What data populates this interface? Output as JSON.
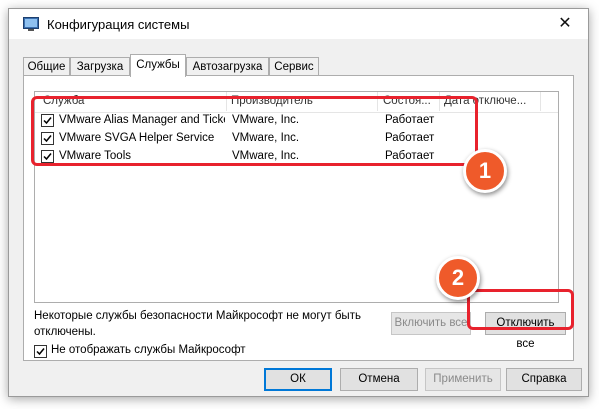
{
  "window": {
    "title": "Конфигурация системы",
    "close_glyph": "✕",
    "icon": "system-config-icon"
  },
  "tabs": [
    {
      "label": "Общие",
      "active": false
    },
    {
      "label": "Загрузка",
      "active": false
    },
    {
      "label": "Службы",
      "active": true
    },
    {
      "label": "Автозагрузка",
      "active": false
    },
    {
      "label": "Сервис",
      "active": false
    }
  ],
  "services": {
    "columns": [
      "Служба",
      "Производитель",
      "Состоя...",
      "Дата отключе..."
    ],
    "rows": [
      {
        "checked": true,
        "name": "VMware Alias Manager and Ticke...",
        "manufacturer": "VMware, Inc.",
        "status": "Работает",
        "date": ""
      },
      {
        "checked": true,
        "name": "VMware SVGA Helper Service",
        "manufacturer": "VMware, Inc.",
        "status": "Работает",
        "date": ""
      },
      {
        "checked": true,
        "name": "VMware Tools",
        "manufacturer": "VMware, Inc.",
        "status": "Работает",
        "date": ""
      }
    ]
  },
  "note": "Некоторые службы безопасности Майкрософт не могут быть отключены.",
  "buttons": {
    "enable_all": "Включить все",
    "disable_all": "Отключить все",
    "ok": "ОК",
    "cancel": "Отмена",
    "apply": "Применить",
    "help": "Справка"
  },
  "hide_ms": {
    "label": "Не отображать службы Майкрософт",
    "checked": true
  },
  "annotations": {
    "badge1": "1",
    "badge2": "2",
    "color": "#e8222d",
    "badge_color": "#ef5a2a"
  }
}
